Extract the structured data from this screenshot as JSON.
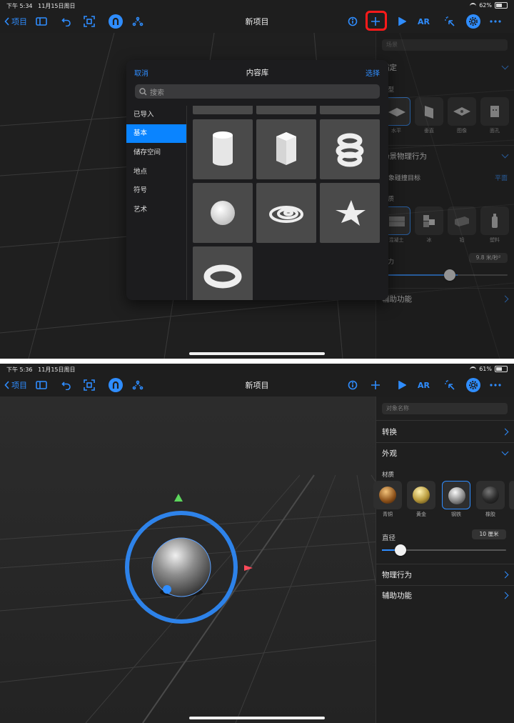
{
  "panel1": {
    "status": {
      "time": "下午 5:34",
      "date": "11月15日周日",
      "battery": "62%",
      "battery_level": 0.62
    },
    "toolbar": {
      "back_label": "项目",
      "title": "新项目",
      "ar_label": "AR"
    },
    "inspector": {
      "scene_field": "场景",
      "anchor_header": "锚定",
      "type_header": "类型",
      "anchor_types": [
        "水平",
        "垂直",
        "图像",
        "面孔"
      ],
      "physics_header": "场景物理行为",
      "collision_label": "对象碰撞目标",
      "collision_value": "平面",
      "material_header": "材质",
      "materials": [
        "混凝土",
        "冰",
        "铅",
        "塑料"
      ],
      "gravity_label": "重力",
      "gravity_value": "9.8 米/秒²",
      "gravity_level": 0.6,
      "accessibility": "辅助功能"
    },
    "library": {
      "cancel": "取消",
      "title": "内容库",
      "select": "选择",
      "search_placeholder": "搜索",
      "categories": [
        "已导入",
        "基本",
        "储存空间",
        "地点",
        "符号",
        "艺术"
      ],
      "selected_category": "基本",
      "items": [
        "cylinder",
        "cube",
        "spiral",
        "sphere",
        "flat-spiral",
        "star",
        "torus"
      ]
    }
  },
  "panel2": {
    "status": {
      "time": "下午 5:36",
      "date": "11月15日周日",
      "battery": "61%",
      "battery_level": 0.61
    },
    "toolbar": {
      "back_label": "项目",
      "title": "新项目",
      "ar_label": "AR"
    },
    "inspector": {
      "name_placeholder": "对象名称",
      "transform": "转换",
      "appearance": "外观",
      "material_label": "材质",
      "materials": [
        "青铜",
        "黄金",
        "钢铁",
        "橡胶"
      ],
      "selected_material": "钢铁",
      "diameter_label": "直径",
      "diameter_value": "10 厘米",
      "diameter_level": 0.15,
      "physics": "物理行为",
      "accessibility": "辅助功能"
    }
  },
  "colors": {
    "accent": "#2f8dff",
    "highlight": "#ff1a1a",
    "selected": "#0a84ff"
  }
}
